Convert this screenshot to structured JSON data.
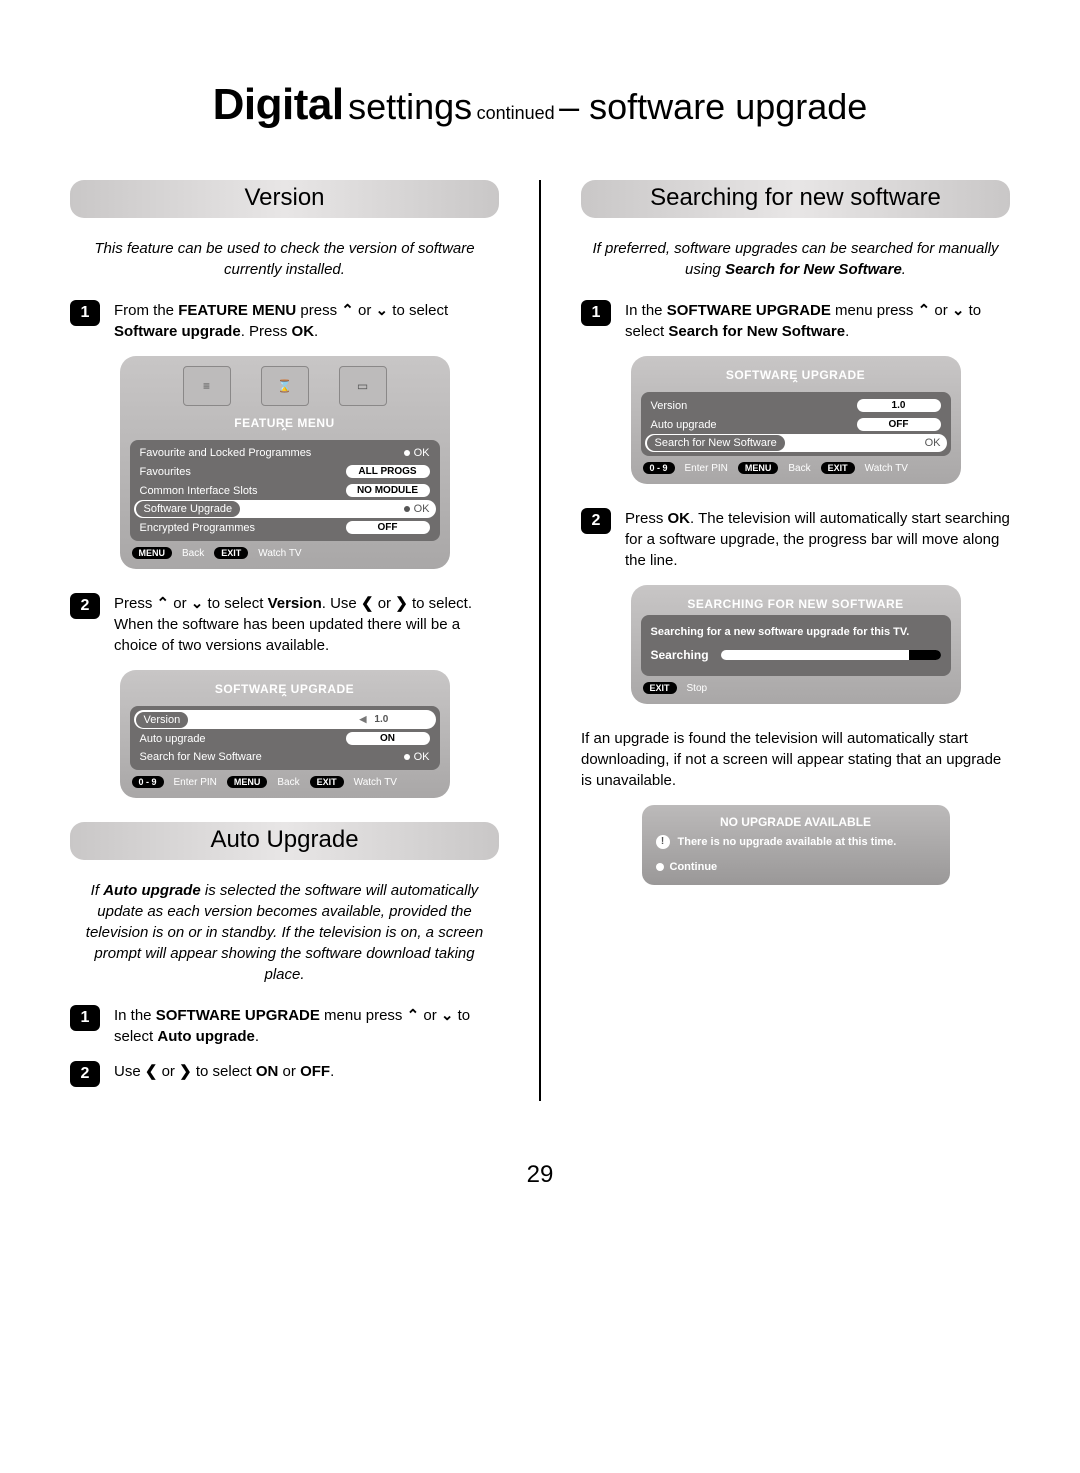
{
  "title": {
    "digital": "Digital",
    "settings": "settings",
    "continued": "continued",
    "dash_software": "– software upgrade"
  },
  "left": {
    "sec1": "Version",
    "intro1": "This feature can be used to check the version of software currently installed.",
    "step1_a": "From the ",
    "step1_b": "FEATURE MENU",
    "step1_c": " press ",
    "step1_up": "⌃",
    "step1_or": " or ",
    "step1_down": "⌄",
    "step1_d": " to select ",
    "step1_e": "Software upgrade",
    "step1_f": ". Press ",
    "step1_g": "OK",
    "step1_h": ".",
    "featureMenu": {
      "title": "FEATURE MENU",
      "rows": [
        {
          "label": "Favourite and Locked Programmes",
          "action": "OK",
          "dot": true
        },
        {
          "label": "Favourites",
          "pill": "ALL PROGS"
        },
        {
          "label": "Common Interface Slots",
          "pill": "NO MODULE"
        },
        {
          "label": "Software Upgrade",
          "action": "OK",
          "dot": true,
          "selected": true
        },
        {
          "label": "Encrypted Programmes",
          "pill": "OFF"
        }
      ],
      "footer": [
        {
          "pill": "MENU",
          "text": "Back"
        },
        {
          "pill": "EXIT",
          "text": "Watch TV"
        }
      ]
    },
    "step2_a": "Press ",
    "step2_up": "⌃",
    "step2_or": " or ",
    "step2_down": "⌄",
    "step2_b": " to select ",
    "step2_c": "Version",
    "step2_d": ". Use ",
    "step2_lt": "❮",
    "step2_or2": " or ",
    "step2_gt": "❯",
    "step2_e": " to select. When the software has been updated there will be a choice of two versions available.",
    "swMenu1": {
      "title": "SOFTWARE UPGRADE",
      "rows": [
        {
          "label": "Version",
          "version": "1.0",
          "highlighted": true
        },
        {
          "label": "Auto upgrade",
          "pill": "ON"
        },
        {
          "label": "Search for New Software",
          "action": "OK",
          "dot": true
        }
      ],
      "footer": [
        {
          "pill": "0 - 9",
          "text": "Enter PIN"
        },
        {
          "pill": "MENU",
          "text": "Back"
        },
        {
          "pill": "EXIT",
          "text": "Watch TV"
        }
      ]
    },
    "sec2": "Auto Upgrade",
    "intro2_a": "If ",
    "intro2_b": "Auto upgrade",
    "intro2_c": " is selected the software will automatically update as each version becomes available, provided the television is on or in standby. If the television is on, a screen prompt will appear showing the software download taking place.",
    "au_step1_a": "In the ",
    "au_step1_b": "SOFTWARE UPGRADE",
    "au_step1_c": " menu press ",
    "au_step1_up": "⌃",
    "au_step1_or": " or ",
    "au_step1_down": "⌄",
    "au_step1_d": " to select ",
    "au_step1_e": "Auto upgrade",
    "au_step1_f": ".",
    "au_step2_a": "Use ",
    "au_step2_lt": "❮",
    "au_step2_or": " or ",
    "au_step2_gt": "❯",
    "au_step2_b": " to select ",
    "au_step2_c": "ON",
    "au_step2_d": " or ",
    "au_step2_e": "OFF",
    "au_step2_f": "."
  },
  "right": {
    "sec1": "Searching for new software",
    "intro_a": "If preferred, software upgrades can be searched for manually using ",
    "intro_b": "Search for New Software",
    "intro_c": ".",
    "step1_a": "In the ",
    "step1_b": "SOFTWARE UPGRADE",
    "step1_c": " menu press ",
    "step1_up": "⌃",
    "step1_or": " or ",
    "step1_down": "⌄",
    "step1_d": " to select ",
    "step1_e": "Search for New Software",
    "step1_f": ".",
    "swMenu2": {
      "title": "SOFTWARE UPGRADE",
      "rows": [
        {
          "label": "Version",
          "pill": "1.0"
        },
        {
          "label": "Auto upgrade",
          "pill": "OFF"
        },
        {
          "label": "Search for New Software",
          "action": "OK",
          "dot": true,
          "highlighted": true
        }
      ],
      "footer": [
        {
          "pill": "0 - 9",
          "text": "Enter PIN"
        },
        {
          "pill": "MENU",
          "text": "Back"
        },
        {
          "pill": "EXIT",
          "text": "Watch TV"
        }
      ]
    },
    "step2_a": "Press ",
    "step2_b": "OK",
    "step2_c": ". The television will automatically start searching for a software upgrade, the progress bar will move along the line.",
    "searching": {
      "title": "SEARCHING FOR NEW SOFTWARE",
      "msg": "Searching for a new software upgrade for this TV.",
      "label": "Searching",
      "footer": [
        {
          "pill": "EXIT",
          "text": "Stop"
        }
      ]
    },
    "para": "If an upgrade is found the television will automatically start downloading, if not a screen will appear stating that an upgrade is unavailable.",
    "noup": {
      "title": "NO UPGRADE AVAILABLE",
      "msg": "There is no upgrade available at this time.",
      "cont": "Continue"
    }
  },
  "pagenum": "29"
}
